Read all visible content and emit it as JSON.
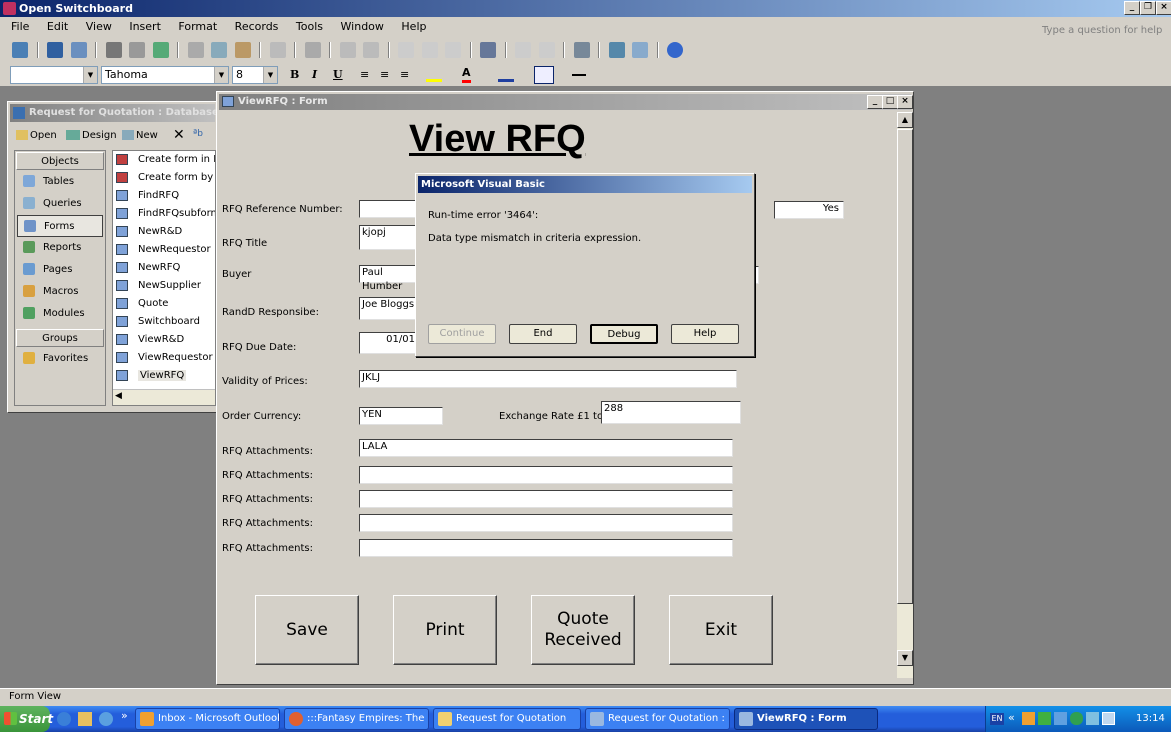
{
  "app": {
    "title": "Open Switchboard",
    "help_placeholder": "Type a question for help",
    "menu": [
      "File",
      "Edit",
      "View",
      "Insert",
      "Format",
      "Records",
      "Tools",
      "Window",
      "Help"
    ],
    "font_name": "Tahoma",
    "font_size": "8"
  },
  "db_window": {
    "title": "Request for Quotation : Database (A",
    "toolbar": {
      "open": "Open",
      "design": "Design",
      "new": "New"
    },
    "objects_header": "Objects",
    "objects": [
      "Tables",
      "Queries",
      "Forms",
      "Reports",
      "Pages",
      "Macros",
      "Modules"
    ],
    "groups_header": "Groups",
    "groups": [
      "Favorites"
    ],
    "items": [
      "Create form in De",
      "Create form by u",
      "FindRFQ",
      "FindRFQsubform",
      "NewR&D",
      "NewRequestor",
      "NewRFQ",
      "NewSupplier",
      "Quote",
      "Switchboard",
      "ViewR&D",
      "ViewRequestor",
      "ViewRFQ"
    ]
  },
  "form": {
    "window_title": "ViewRFQ : Form",
    "heading": "View RFQ",
    "fields": {
      "ref_label": "RFQ Reference Number:",
      "ref_value": "",
      "status_value": "Yes",
      "title_label": "RFQ Title",
      "title_value": "kjopj",
      "buyer_label": "Buyer",
      "buyer_value": "Paul Humber",
      "rnd_label": "RandD Responsibe:",
      "rnd_value": "Joe Bloggs",
      "due_label": "RFQ Due Date:",
      "due_value": "01/01",
      "validity_label": "Validity of Prices:",
      "validity_value": "JKLJ",
      "currency_label": "Order Currency:",
      "currency_value": "YEN",
      "exchange_label": "Exchange Rate £1 to:",
      "exchange_value": "288"
    },
    "attachments": [
      {
        "label": "RFQ Attachments:",
        "value": "LALA"
      },
      {
        "label": "RFQ Attachments:",
        "value": ""
      },
      {
        "label": "RFQ Attachments:",
        "value": ""
      },
      {
        "label": "RFQ Attachments:",
        "value": ""
      },
      {
        "label": "RFQ Attachments:",
        "value": ""
      }
    ],
    "buttons": {
      "save": "Save",
      "print": "Print",
      "quote": "Quote Received",
      "exit": "Exit"
    }
  },
  "dialog": {
    "title": "Microsoft Visual Basic",
    "error": "Run-time error '3464':",
    "message": "Data type mismatch in criteria expression.",
    "buttons": {
      "continue": "Continue",
      "end": "End",
      "debug": "Debug",
      "help": "Help"
    }
  },
  "status": {
    "text": "Form View"
  },
  "taskbar": {
    "start": "Start",
    "tasks": [
      "Inbox - Microsoft Outlook",
      ":::Fantasy Empires: The ...",
      "Request for Quotation",
      "Request for Quotation : ...",
      "ViewRFQ : Form"
    ],
    "lang": "EN",
    "time": "13:14"
  },
  "colors": {
    "titlebar": "#0a246a",
    "face": "#d4d0c8",
    "desktop": "#808080",
    "taskbar": "#245edb"
  }
}
